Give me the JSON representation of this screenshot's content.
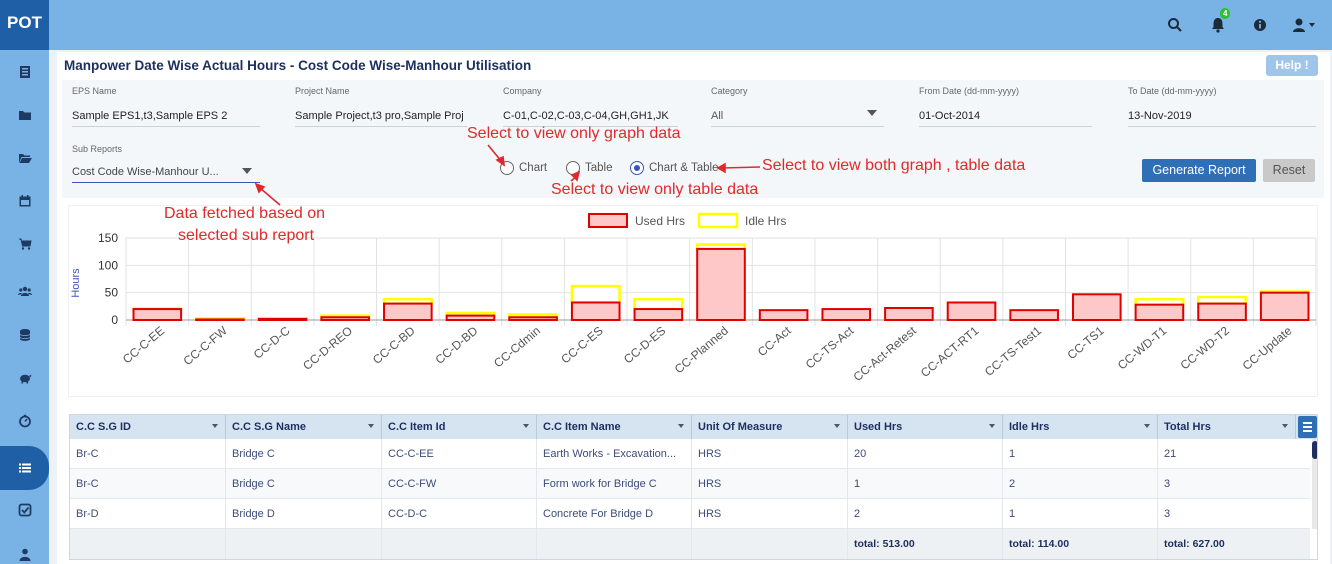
{
  "app": {
    "logo": "POT",
    "notification_count": "4"
  },
  "topbar_icons": [
    "search-icon",
    "bell-icon",
    "info-icon",
    "user-icon"
  ],
  "sidebar": {
    "items": [
      "dashboard-icon",
      "folder-icon",
      "folder-open-icon",
      "calendar-icon",
      "cart-icon",
      "users-icon",
      "database-icon",
      "piggy-bank-icon",
      "gauge-icon",
      "list-icon",
      "check-square-icon",
      "user-icon"
    ],
    "active_index": 9
  },
  "page": {
    "title": "Manpower Date Wise Actual Hours - Cost Code Wise-Manhour Utilisation",
    "help": "Help !"
  },
  "form": {
    "eps": {
      "label": "EPS Name",
      "value": "Sample EPS1,t3,Sample EPS 2"
    },
    "project": {
      "label": "Project Name",
      "value": "Sample Project,t3 pro,Sample Proj"
    },
    "company": {
      "label": "Company",
      "value": "C-01,C-02,C-03,C-04,GH,GH1,JK"
    },
    "category": {
      "label": "Category",
      "value": "All"
    },
    "from_date": {
      "label": "From Date (dd-mm-yyyy)",
      "value": "01-Oct-2014"
    },
    "to_date": {
      "label": "To Date (dd-mm-yyyy)",
      "value": "13-Nov-2019"
    },
    "sub_reports": {
      "label": "Sub Reports",
      "value": "Cost Code Wise-Manhour U..."
    },
    "view_options": [
      "Chart",
      "Table",
      "Chart & Table"
    ],
    "selected_view": "Chart & Table",
    "generate": "Generate Report",
    "reset": "Reset"
  },
  "annotations": {
    "graph_only": "Select to view only graph data",
    "table_only": "Select to view only table data",
    "both": "Select to view both graph , table data",
    "sub_report_line1": "Data fetched based on",
    "sub_report_line2": "selected sub report"
  },
  "colors": {
    "used_fill": "#ffc8c8",
    "used_stroke": "#e00000",
    "idle_stroke": "#ffff00",
    "primary": "#2e6fb5"
  },
  "chart_data": {
    "type": "bar",
    "stacked": true,
    "title": "",
    "xlabel": "",
    "ylabel": "Hours",
    "ylim": [
      0,
      150
    ],
    "yticks": [
      0,
      50,
      100,
      150
    ],
    "legend_position": "top-center",
    "grid": true,
    "categories": [
      "CC-C-EE",
      "CC-C-FW",
      "CC-D-C",
      "CC-D-REO",
      "CC-C-BD",
      "CC-D-BD",
      "CC-Cdmin",
      "CC-C-ES",
      "CC-D-ES",
      "CC-Planned",
      "CC-Act",
      "CC-TS-Act",
      "CC-Act-Retest",
      "CC-ACT-RT1",
      "CC-TS-Test1",
      "CC-TS1",
      "CC-WD-T1",
      "CC-WD-T2",
      "CC-Update"
    ],
    "series": [
      {
        "name": "Used Hrs",
        "values": [
          20,
          1,
          2,
          5,
          30,
          8,
          5,
          32,
          20,
          130,
          18,
          20,
          22,
          32,
          18,
          47,
          28,
          30,
          50
        ]
      },
      {
        "name": "Idle Hrs",
        "values": [
          1,
          2,
          1,
          3,
          8,
          5,
          5,
          30,
          18,
          8,
          0,
          0,
          0,
          0,
          0,
          0,
          10,
          12,
          2
        ]
      }
    ]
  },
  "table": {
    "columns": [
      "C.C S.G ID",
      "C.C S.G Name",
      "C.C Item Id",
      "C.C Item Name",
      "Unit Of Measure",
      "Used Hrs",
      "Idle Hrs",
      "Total Hrs"
    ],
    "rows": [
      [
        "Br-C",
        "Bridge C",
        "CC-C-EE",
        "Earth Works - Excavation...",
        "HRS",
        "20",
        "1",
        "21"
      ],
      [
        "Br-C",
        "Bridge C",
        "CC-C-FW",
        "Form work for Bridge C",
        "HRS",
        "1",
        "2",
        "3"
      ],
      [
        "Br-D",
        "Bridge D",
        "CC-D-C",
        "Concrete For Bridge D",
        "HRS",
        "2",
        "1",
        "3"
      ]
    ],
    "totals": [
      "total: 513.00",
      "total: 114.00",
      "total: 627.00"
    ]
  }
}
